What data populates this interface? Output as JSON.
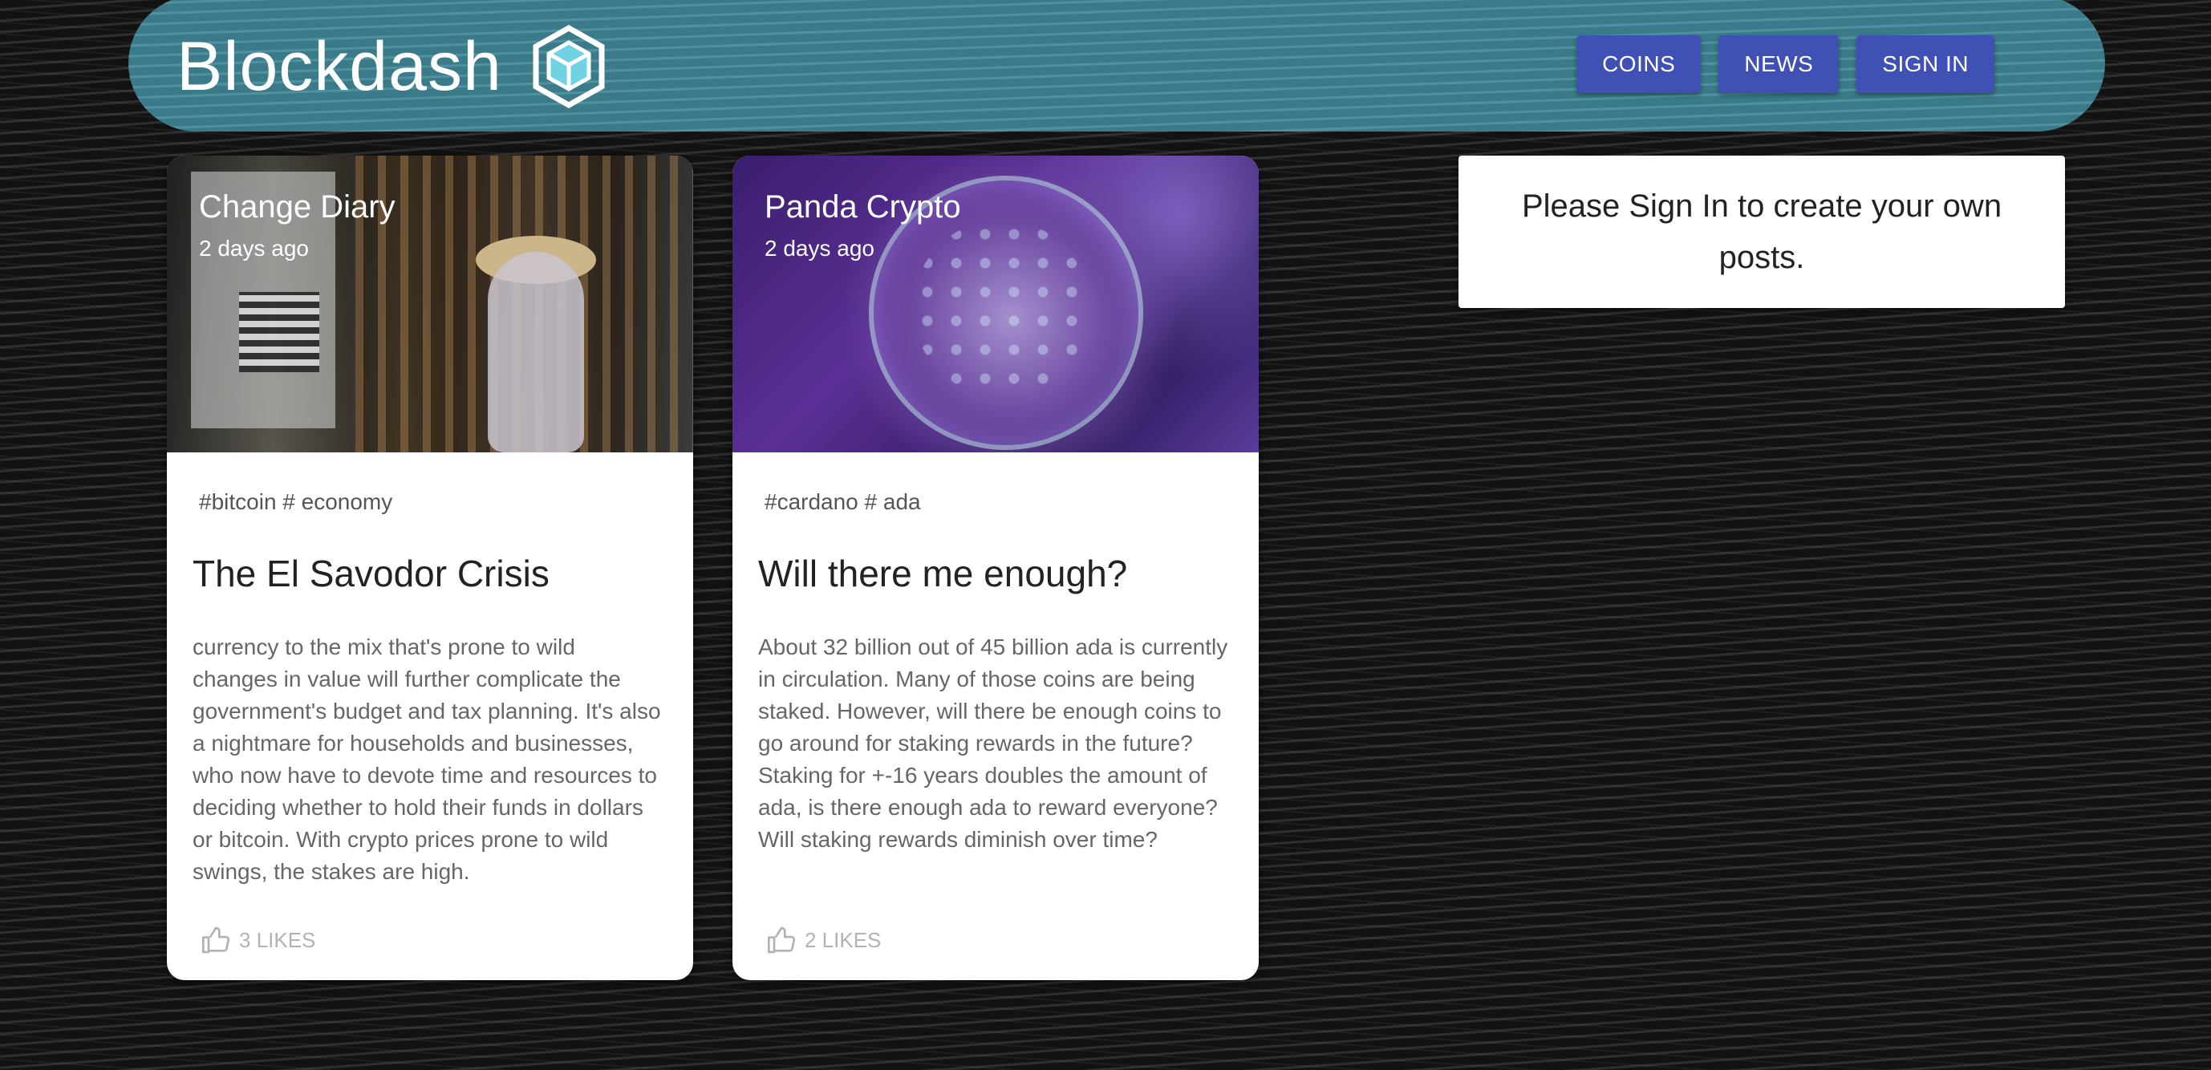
{
  "header": {
    "brand": "Blockdash",
    "logo_icon": "cube-logo-icon",
    "nav": [
      {
        "label": "COINS"
      },
      {
        "label": "NEWS"
      },
      {
        "label": "SIGN IN"
      }
    ],
    "colors": {
      "header_bg": "#3b7a88",
      "button_bg": "#3f51b5"
    }
  },
  "posts": [
    {
      "author": "Change Diary",
      "time": "2 days ago",
      "tags": "#bitcoin # economy",
      "title": "The El Savodor Crisis",
      "text": "currency to the mix that's prone to wild changes in value will further complicate the government's budget and tax planning. It's also a nightmare for households and businesses, who now have to devote time and resources to deciding whether to hold their funds in dollars or bitcoin. With crypto prices prone to wild swings, the stakes are high.",
      "likes": "3 LIKES"
    },
    {
      "author": "Panda Crypto",
      "time": "2 days ago",
      "tags": "#cardano # ada",
      "title": "Will there me enough?",
      "text": "About 32 billion out of 45 billion ada is currently in circulation. Many of those coins are being staked. However, will there be enough coins to go around for staking rewards in the future? Staking for +-16 years doubles the amount of ada, is there enough ada to reward everyone? Will staking rewards diminish over time?",
      "likes": "2 LIKES"
    }
  ],
  "sidebar": {
    "message": "Please Sign In to create your own posts."
  }
}
